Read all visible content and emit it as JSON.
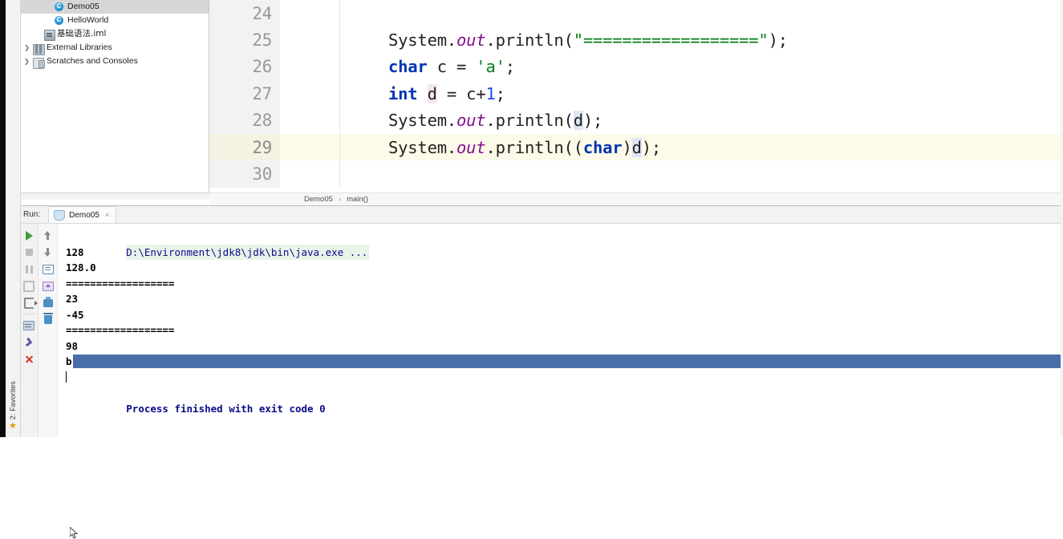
{
  "window": {
    "left_stripe": {
      "favorites_label": "2: Favorites",
      "star_icon": "star-icon"
    }
  },
  "project_tree": {
    "items": [
      {
        "label": "Demo05",
        "icon": "java-class-icon",
        "indent": 2,
        "expandable": false,
        "selected": true
      },
      {
        "label": "HelloWorld",
        "icon": "java-class-icon",
        "indent": 2,
        "expandable": false,
        "selected": false
      },
      {
        "label": "基础语法.iml",
        "icon": "module-file-icon",
        "indent": 1,
        "expandable": false,
        "selected": false,
        "cjk": true
      },
      {
        "label": "External Libraries",
        "icon": "library-icon",
        "indent": 0,
        "expandable": true,
        "selected": false
      },
      {
        "label": "Scratches and Consoles",
        "icon": "scratches-icon",
        "indent": 0,
        "expandable": true,
        "selected": false
      }
    ]
  },
  "editor": {
    "lines": [
      {
        "number": "24",
        "current": false,
        "tokens": []
      },
      {
        "number": "25",
        "current": false,
        "tokens": [
          {
            "t": "System.",
            "c": ""
          },
          {
            "t": "out",
            "c": "field-it"
          },
          {
            "t": ".println(",
            "c": ""
          },
          {
            "t": "\"==================\"",
            "c": "str"
          },
          {
            "t": ");",
            "c": ""
          }
        ]
      },
      {
        "number": "26",
        "current": false,
        "tokens": [
          {
            "t": "char",
            "c": "kw"
          },
          {
            "t": " c = ",
            "c": ""
          },
          {
            "t": "'a'",
            "c": "str"
          },
          {
            "t": ";",
            "c": ""
          }
        ]
      },
      {
        "number": "27",
        "current": false,
        "tokens": [
          {
            "t": "int",
            "c": "kw"
          },
          {
            "t": " ",
            "c": ""
          },
          {
            "t": "d",
            "c": "hl-pink"
          },
          {
            "t": " = c+",
            "c": ""
          },
          {
            "t": "1",
            "c": "num"
          },
          {
            "t": ";",
            "c": ""
          }
        ]
      },
      {
        "number": "28",
        "current": false,
        "tokens": [
          {
            "t": "System.",
            "c": ""
          },
          {
            "t": "out",
            "c": "field-it"
          },
          {
            "t": ".println(",
            "c": ""
          },
          {
            "t": "d",
            "c": "hl-var"
          },
          {
            "t": ");",
            "c": ""
          }
        ]
      },
      {
        "number": "29",
        "current": true,
        "tokens": [
          {
            "t": "System.",
            "c": ""
          },
          {
            "t": "out",
            "c": "field-it"
          },
          {
            "t": ".println((",
            "c": ""
          },
          {
            "t": "char",
            "c": "kw"
          },
          {
            "t": ")",
            "c": ""
          },
          {
            "t": "d",
            "c": "hl-var"
          },
          {
            "t": ");",
            "c": ""
          }
        ]
      },
      {
        "number": "30",
        "current": false,
        "tokens": []
      }
    ],
    "breadcrumb": {
      "class": "Demo05",
      "separator": "›",
      "method": "main()"
    }
  },
  "run_window": {
    "title": "Run:",
    "tab": {
      "label": "Demo05",
      "icon": "run-config-icon",
      "close": "×"
    },
    "rail_primary": [
      {
        "name": "rerun-button",
        "glyph": "g-play"
      },
      {
        "name": "stop-button",
        "glyph": "g-stop"
      },
      {
        "name": "pause-button",
        "glyph": "g-pause"
      },
      {
        "name": "resume-button",
        "glyph": "g-grid"
      },
      {
        "name": "exit-button",
        "glyph": "g-exit"
      },
      {
        "name": "console-view-button",
        "glyph": "g-console"
      },
      {
        "name": "pin-tab-button",
        "glyph": "g-pin"
      },
      {
        "name": "close-tab-button",
        "glyph": "g-close-x"
      }
    ],
    "rail_secondary": [
      {
        "name": "scroll-up-button",
        "glyph": "g-arrow-up"
      },
      {
        "name": "scroll-down-button",
        "glyph": "g-arrow-dn"
      },
      {
        "name": "soft-wrap-button",
        "glyph": "g-wrap"
      },
      {
        "name": "export-output-button",
        "glyph": "g-upload"
      },
      {
        "name": "print-button",
        "glyph": "g-print"
      },
      {
        "name": "clear-all-button",
        "glyph": "g-trash"
      }
    ],
    "console": {
      "command_line": "D:\\Environment\\jdk8\\jdk\\bin\\java.exe ...",
      "output_lines": [
        {
          "text": "128",
          "style": "out"
        },
        {
          "text": "128.0",
          "style": "out"
        },
        {
          "text": "==================",
          "style": "out"
        },
        {
          "text": "23",
          "style": "out"
        },
        {
          "text": "-45",
          "style": "out"
        },
        {
          "text": "==================",
          "style": "out"
        },
        {
          "text": "98",
          "style": "out"
        },
        {
          "text": "b",
          "style": "out-selected"
        },
        {
          "text": "",
          "style": "caret"
        }
      ],
      "exit_line": "Process finished with exit code 0",
      "selection_color": "#4a6ea9"
    }
  },
  "colors": {
    "keyword": "#0033b3",
    "string": "#067d17",
    "number": "#1750eb",
    "field": "#871094",
    "current_line": "#fcfae8",
    "selection": "#4a6ea9",
    "console_command": "#0a0a8a"
  }
}
